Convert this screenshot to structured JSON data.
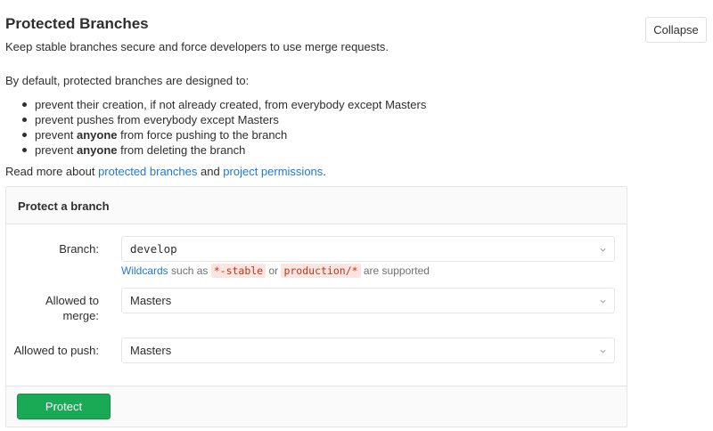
{
  "header": {
    "title": "Protected Branches",
    "subtitle": "Keep stable branches secure and force developers to use merge requests.",
    "collapse_label": "Collapse"
  },
  "intro": "By default, protected branches are designed to:",
  "rules": [
    {
      "before": "prevent their creation, if not already created, from everybody except Masters",
      "bold": "",
      "after": ""
    },
    {
      "before": "prevent pushes from everybody except Masters",
      "bold": "",
      "after": ""
    },
    {
      "before": "prevent ",
      "bold": "anyone",
      "after": " from force pushing to the branch"
    },
    {
      "before": "prevent ",
      "bold": "anyone",
      "after": " from deleting the branch"
    }
  ],
  "readmore": {
    "prefix": "Read more about ",
    "link1": "protected branches",
    "middle": " and ",
    "link2": "project permissions",
    "suffix": "."
  },
  "form": {
    "panel_title": "Protect a branch",
    "branch_label": "Branch:",
    "branch_value": "develop",
    "hint_link": "Wildcards",
    "hint_text1": " such as ",
    "hint_code1": "*-stable",
    "hint_text2": " or ",
    "hint_code2": "production/*",
    "hint_text3": " are supported",
    "merge_label_line1": "Allowed to",
    "merge_label_line2": "merge:",
    "merge_value": "Masters",
    "push_label": "Allowed to push:",
    "push_value": "Masters",
    "protect_label": "Protect"
  },
  "icons": {
    "dropdown": "chevron-down-icon"
  },
  "colors": {
    "link": "#1f78d1",
    "protect_button": "#1aaa55",
    "code_text": "#c0341d",
    "code_bg": "#fbe5e1"
  }
}
